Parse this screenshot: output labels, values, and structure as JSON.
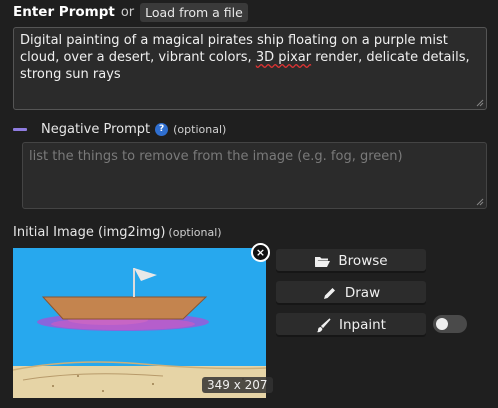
{
  "prompt": {
    "title": "Enter Prompt",
    "or": "or",
    "load_button": "Load from a file",
    "text_part1": "Digital painting of a magical pirates ship floating on a purple mist cloud, over a desert, vibrant colors, ",
    "text_misspelled": "3D pixar",
    "text_part2": " render, delicate details, strong sun rays"
  },
  "negative": {
    "label": "Negative Prompt",
    "help_icon": "?",
    "optional": "(optional)",
    "placeholder": "list the things to remove from the image (e.g. fog, green)"
  },
  "init_image": {
    "label": "Initial Image (img2img)",
    "optional": "(optional)",
    "dimensions": "349 x 207",
    "close_icon": "×"
  },
  "actions": {
    "browse": "Browse",
    "draw": "Draw",
    "inpaint": "Inpaint",
    "inpaint_toggle_on": false
  },
  "colors": {
    "accent_minus": "#8f7ce0",
    "help_icon": "#2f6fd0"
  }
}
